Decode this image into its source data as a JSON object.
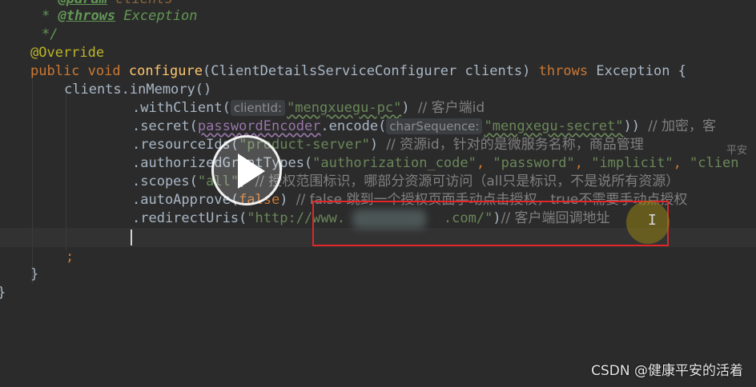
{
  "editor": {
    "doc_param_tag": "@param",
    "doc_param_name": "clients",
    "doc_throws_star": "*",
    "doc_throws_tag": "@throws",
    "doc_throws_type": "Exception",
    "doc_end": "*/",
    "override": "@Override",
    "kw_public": "public",
    "kw_void": "void",
    "method_name": "configure",
    "param_open": "(ClientDetailsServiceConfigurer clients)",
    "kw_throws": "throws",
    "throws_type": "Exception {",
    "in_memory": "clients.inMemory()",
    "with_client_call": ".withClient(",
    "hint_client_id": "clientId:",
    "client_id_value": "\"mengxuegu-pc\"",
    "with_client_close": ")",
    "comment_client": "// 客户端id",
    "secret_call": ".secret(",
    "password_encoder": "passwordEncoder",
    "encode_call": ".encode(",
    "hint_char_sequence": "charSequence:",
    "secret_value": "\"mengxegu-secret\"",
    "secret_close": "))",
    "comment_secret": "// 加密，客",
    "resource_call": ".resourceIds(",
    "resource_value": "\"product-server\"",
    "resource_close": ")",
    "comment_resource": "// 资源id，针对的是微服务名称，商品管理",
    "trail_text": "平安",
    "grant_call": ".authorizedGrantTypes(",
    "grant_auth_code": "\"authorization_code\"",
    "grant_sep1": ", ",
    "grant_password": "\"password\"",
    "grant_sep2": ", ",
    "grant_implicit": "\"implicit\"",
    "grant_sep3": ", ",
    "grant_client": "\"clien",
    "scopes_call": ".scopes(",
    "scopes_value": "\"all\"",
    "scopes_close": ")",
    "comment_scopes": "// 授权范围标识，哪部分资源可访问（all只是标识，不是说所有资源）",
    "approve_call": ".autoApprove(",
    "approve_value": "false",
    "approve_close": ")",
    "comment_approve": "// false 跳到一个授权页面手动点击授权，true不需要手动点授权",
    "redirect_call": ".redirectUris(",
    "redirect_value": "\"http://www.            .com/\"",
    "redirect_close": ")",
    "comment_redirect": "// 客户端回调地址",
    "semicolon": ";",
    "brace_close_method": "}",
    "brace_close_class": "}"
  },
  "overlay": {
    "watermark": "CSDN @健康平安的活着",
    "play_icon": "play-icon",
    "cursor_icon": "i-beam-cursor-icon"
  },
  "colors": {
    "background": "#2b2b2b",
    "keyword": "#cc7832",
    "string": "#6a8759",
    "method": "#ffc66d",
    "annotation": "#bbb529",
    "highlight_box": "#e0262a"
  }
}
